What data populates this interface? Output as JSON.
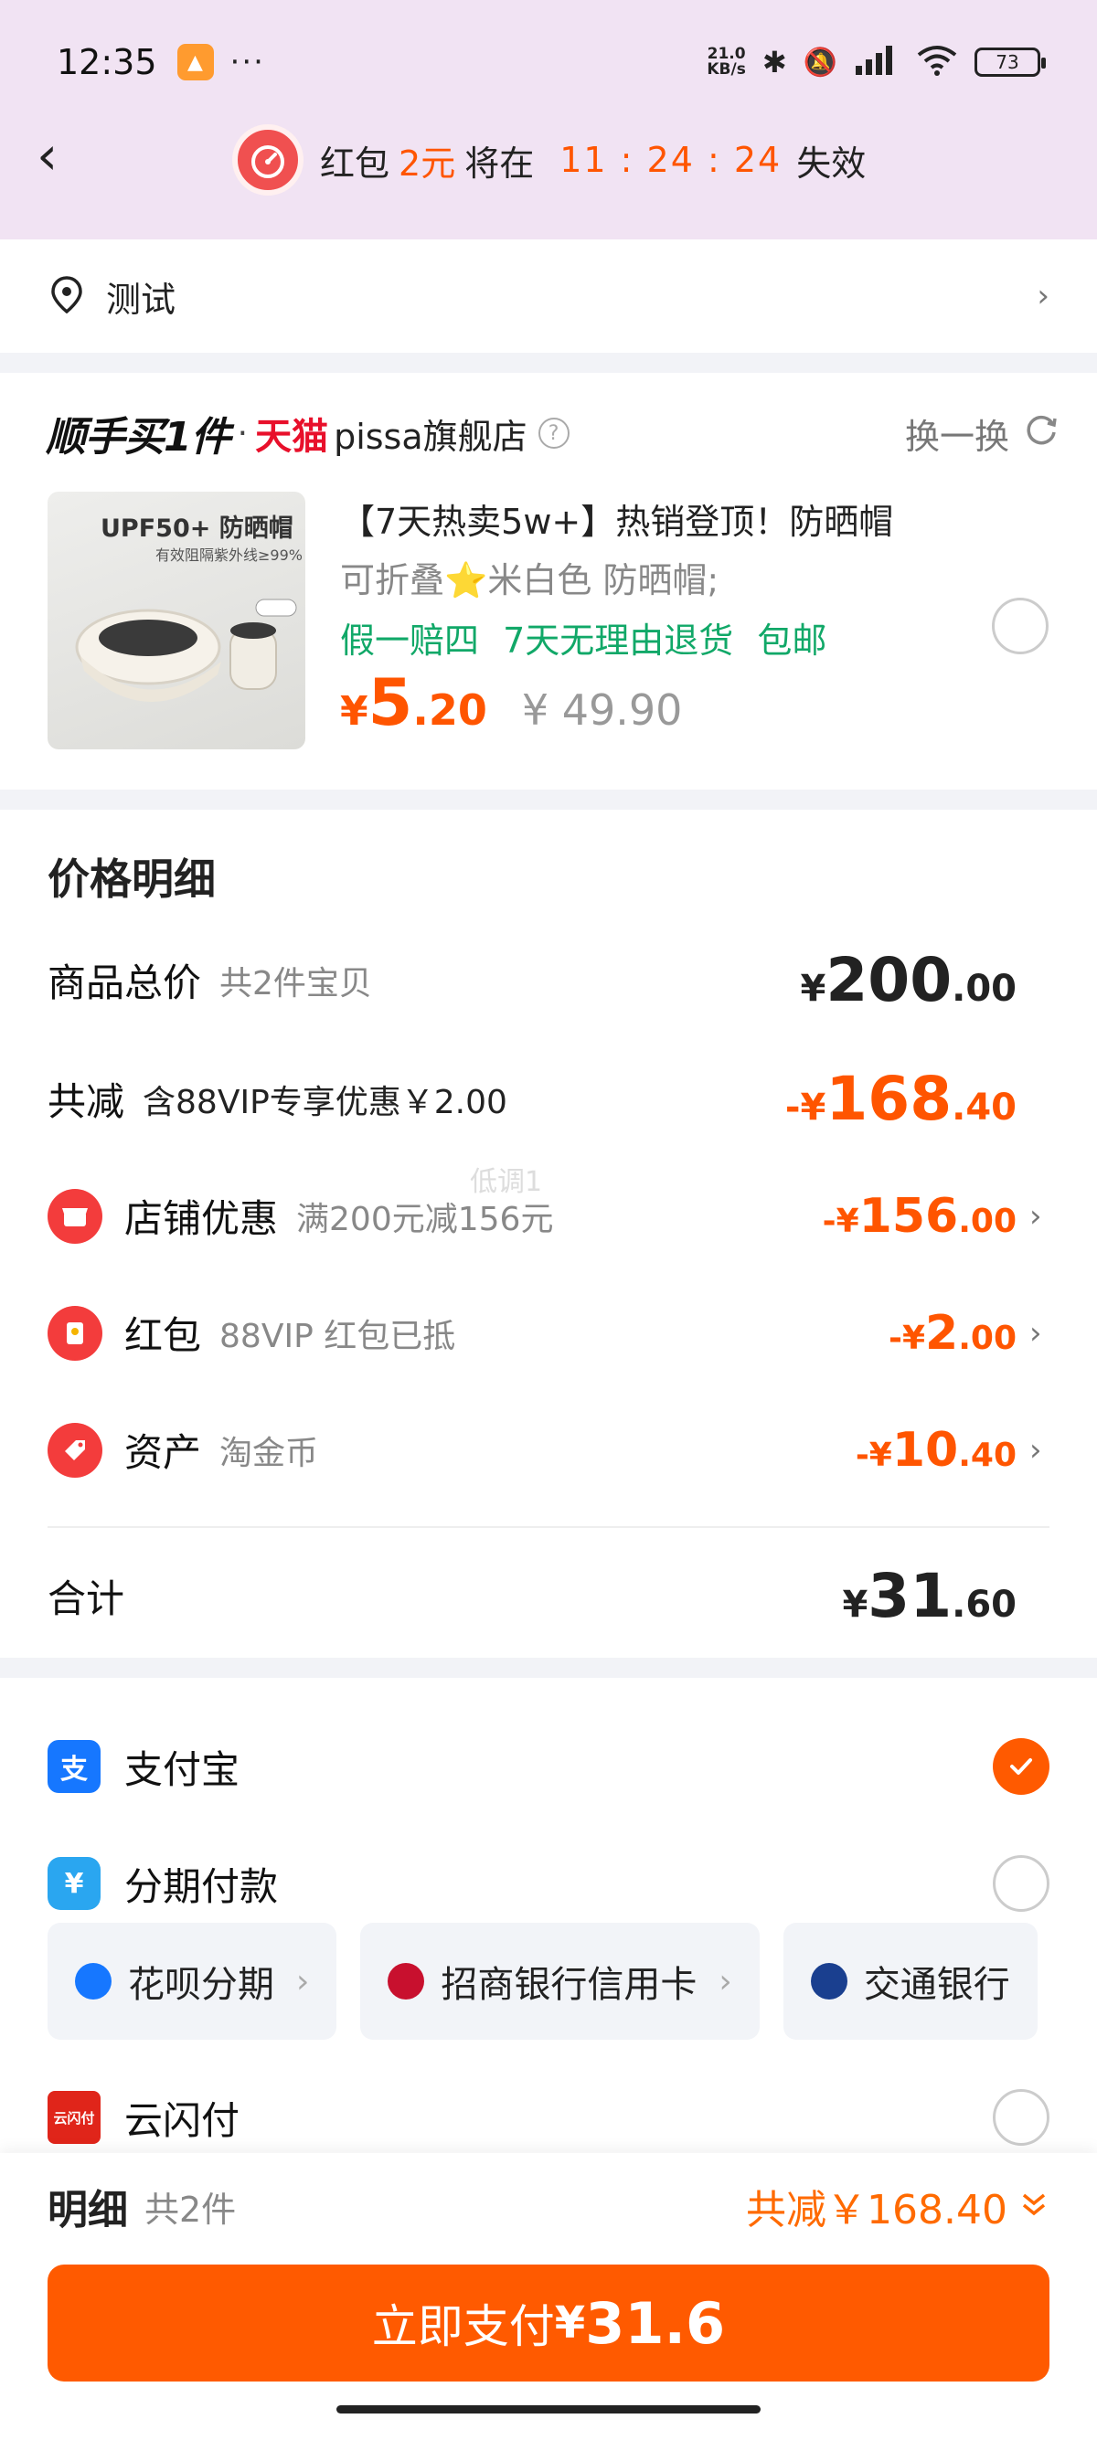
{
  "status_bar": {
    "time": "12:35",
    "dots": "···",
    "speed": "21.0\nKB/s",
    "battery": "73"
  },
  "header": {
    "redpacket_prefix": "红包",
    "redpacket_amount": "2元",
    "redpacket_mid": "将在",
    "countdown": "11 : 24 : 24",
    "redpacket_suffix": "失效"
  },
  "address": {
    "label": "测试"
  },
  "upsell": {
    "logo": "顺手买1件",
    "dot": "·",
    "platform": "天猫",
    "shop": "pissa旗舰店",
    "swap_label": "换一换",
    "product": {
      "image_text": "UPF50+ 防晒帽",
      "image_subtext": "有效阻隔紫外线≥99%",
      "title": "【7天热卖5w+】热销登顶！防晒帽",
      "subtitle": "可折叠⭐米白色 防晒帽;",
      "tags": "假一赔四 7天无理由退货 包邮",
      "price_symbol": "¥",
      "price_int": "5",
      "price_dec": ".20",
      "original_price": "¥ 49.90"
    }
  },
  "price_detail": {
    "title": "价格明细",
    "total": {
      "label": "商品总价",
      "note": "共2件宝贝",
      "sym": "¥",
      "int": "200",
      "dec": ".00"
    },
    "reduced": {
      "label": "共减",
      "note": "含88VIP专享优惠￥2.00",
      "sym": "-¥",
      "int": "168",
      "dec": ".40"
    },
    "shop_discount": {
      "label": "店铺优惠",
      "note": "满200元减156元",
      "sym": "-¥",
      "int": "156",
      "dec": ".00"
    },
    "red_packet": {
      "label": "红包",
      "note": "88VIP 红包已抵",
      "sym": "-¥",
      "int": "2",
      "dec": ".00"
    },
    "assets": {
      "label": "资产",
      "note": "淘金币",
      "sym": "-¥",
      "int": "10",
      "dec": ".40"
    },
    "watermark": "低调1",
    "sum": {
      "label": "合计",
      "sym": "¥",
      "int": "31",
      "dec": ".60"
    }
  },
  "payment": {
    "alipay": "支付宝",
    "installment": "分期付款",
    "chips": [
      {
        "label": "花呗分期",
        "color": "#1677ff"
      },
      {
        "label": "招商银行信用卡",
        "color": "#c8102e"
      },
      {
        "label": "交通银行",
        "color": "#1a3f8f"
      }
    ],
    "unionpay": "云闪付",
    "unionpay_badge": "云闪付"
  },
  "bottom": {
    "label": "明细",
    "count": "共2件",
    "discount": "共减￥168.40",
    "pay_text": "立即支付",
    "pay_sym": "¥",
    "pay_amount": "31.6"
  },
  "colors": {
    "accent": "#ff5a00",
    "header_bg": "#f1e3f3",
    "green": "#11a868"
  }
}
